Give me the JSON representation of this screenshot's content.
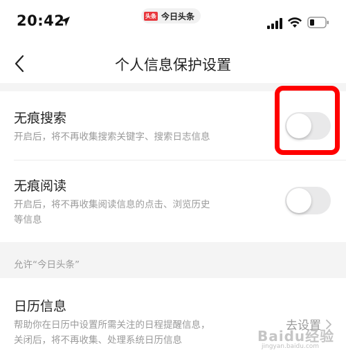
{
  "status_bar": {
    "time": "20:42",
    "app_logo_text": "头条",
    "app_name": "今日头条"
  },
  "nav": {
    "title": "个人信息保护设置"
  },
  "settings": [
    {
      "title": "无痕搜索",
      "description": "开启后，将不再收集搜索关键字、搜索日志信息",
      "enabled": false
    },
    {
      "title": "无痕阅读",
      "description_line1": "开启后，将不再收集阅读信息的点击、浏览历史",
      "description_line2": "等信息",
      "enabled": false
    }
  ],
  "permissions_section": {
    "header": "允许“今日头条”",
    "calendar": {
      "title": "日历信息",
      "description_line1": "帮助你在日历中设置所需关注的日程提醒信息，",
      "description_line2": "关闭后，将不再收集、处理系统日历信息",
      "action_label": "去设置"
    }
  },
  "watermark": {
    "text": "Baidu经验",
    "sub": "jingyan.baidu.com"
  },
  "colors": {
    "highlight": "#ff0000",
    "toggle_off": "#e9e9ea",
    "secondary_text": "#9a9a9a",
    "section_bg": "#f4f4f4"
  }
}
